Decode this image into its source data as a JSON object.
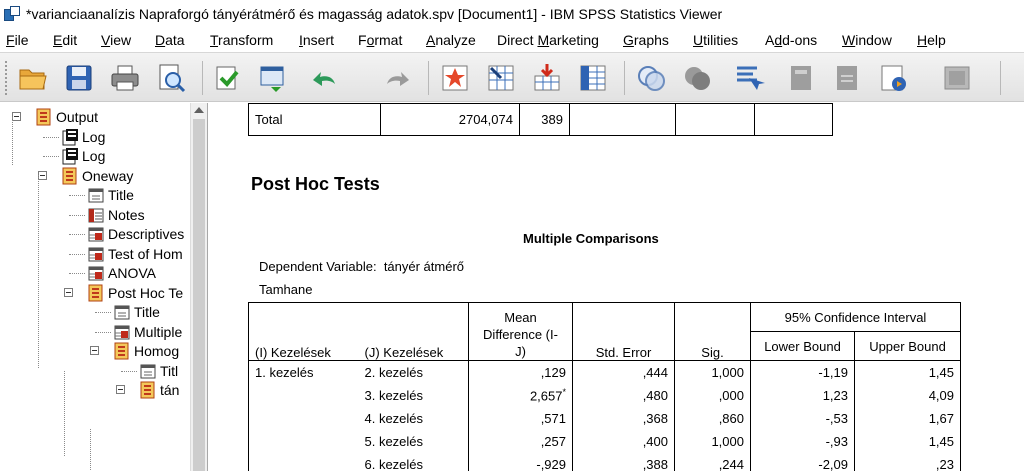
{
  "window": {
    "title": "*varianciaanalízis Napraforgó tányérátmérő és magasság adatok.spv [Document1] - IBM SPSS Statistics Viewer"
  },
  "menu": [
    {
      "label": "File",
      "accel": "F"
    },
    {
      "label": "Edit",
      "accel": "E"
    },
    {
      "label": "View",
      "accel": "V"
    },
    {
      "label": "Data",
      "accel": "D"
    },
    {
      "label": "Transform",
      "accel": "T"
    },
    {
      "label": "Insert",
      "accel": "I"
    },
    {
      "label": "Format",
      "accel": "o"
    },
    {
      "label": "Analyze",
      "accel": "A"
    },
    {
      "label": "Direct Marketing",
      "accel": "M"
    },
    {
      "label": "Graphs",
      "accel": "G"
    },
    {
      "label": "Utilities",
      "accel": "U"
    },
    {
      "label": "Add-ons",
      "accel": "d"
    },
    {
      "label": "Window",
      "accel": "W"
    },
    {
      "label": "Help",
      "accel": "H"
    }
  ],
  "toolbar": [
    {
      "name": "open-icon"
    },
    {
      "name": "save-icon"
    },
    {
      "name": "print-icon"
    },
    {
      "name": "print-preview-icon"
    },
    {
      "name": "export-icon"
    },
    {
      "name": "recall-dialog-icon"
    },
    {
      "name": "undo-icon"
    },
    {
      "name": "redo-icon"
    },
    {
      "name": "goto-data-icon"
    },
    {
      "name": "goto-case-icon"
    },
    {
      "name": "goto-variable-icon"
    },
    {
      "name": "variables-icon"
    },
    {
      "name": "show-all-variables-icon"
    },
    {
      "name": "designate-window-icon"
    },
    {
      "name": "select-output-icon"
    },
    {
      "name": "promote-icon"
    },
    {
      "name": "demote-icon"
    },
    {
      "name": "create-title-icon"
    },
    {
      "name": "insert-output-icon"
    }
  ],
  "outline": {
    "items": [
      {
        "label": "Output",
        "icon": "output-book-icon"
      },
      {
        "label": "Log",
        "icon": "log-icon"
      },
      {
        "label": "Log",
        "icon": "log-icon"
      },
      {
        "label": "Oneway",
        "icon": "procedure-book-icon"
      },
      {
        "label": "Title",
        "icon": "title-icon"
      },
      {
        "label": "Notes",
        "icon": "notes-icon"
      },
      {
        "label": "Descriptives",
        "icon": "table-icon"
      },
      {
        "label": "Test of Hom",
        "icon": "table-icon"
      },
      {
        "label": "ANOVA",
        "icon": "table-icon"
      },
      {
        "label": "Post Hoc Te",
        "icon": "procedure-book-icon"
      },
      {
        "label": "Title",
        "icon": "title-icon"
      },
      {
        "label": "Multiple",
        "icon": "table-icon"
      },
      {
        "label": "Homog",
        "icon": "procedure-book-icon"
      },
      {
        "label": "Titl",
        "icon": "title-icon"
      },
      {
        "label": "tán",
        "icon": "procedure-book-icon"
      }
    ]
  },
  "anova_tail": {
    "label": "Total",
    "sum_sq": "2704,074",
    "df": "389"
  },
  "section_title": "Post Hoc Tests",
  "multiple_comparisons": {
    "title": "Multiple Comparisons",
    "dependent_variable_label": "Dependent Variable:",
    "dependent_variable": "tányér átmérő",
    "method": "Tamhane",
    "headers": {
      "i": "(I) Kezelések",
      "j": "(J) Kezelések",
      "mean_diff_1": "Mean",
      "mean_diff_2": "Difference (I-",
      "mean_diff_3": "J)",
      "std_error": "Std. Error",
      "sig": "Sig.",
      "ci": "95% Confidence Interval",
      "lower": "Lower Bound",
      "upper": "Upper Bound"
    },
    "group_i": "1. kezelés",
    "rows": [
      {
        "j": "2. kezelés",
        "md": ",129",
        "star": "",
        "se": ",444",
        "sig": "1,000",
        "lo": "-1,19",
        "hi": "1,45"
      },
      {
        "j": "3. kezelés",
        "md": "2,657",
        "star": "*",
        "se": ",480",
        "sig": ",000",
        "lo": "1,23",
        "hi": "4,09"
      },
      {
        "j": "4. kezelés",
        "md": ",571",
        "star": "",
        "se": ",368",
        "sig": ",860",
        "lo": "-,53",
        "hi": "1,67"
      },
      {
        "j": "5. kezelés",
        "md": ",257",
        "star": "",
        "se": ",400",
        "sig": "1,000",
        "lo": "-,93",
        "hi": "1,45"
      },
      {
        "j": "6. kezelés",
        "md": "-,929",
        "star": "",
        "se": ",388",
        "sig": ",244",
        "lo": "-2,09",
        "hi": ",23"
      }
    ]
  }
}
